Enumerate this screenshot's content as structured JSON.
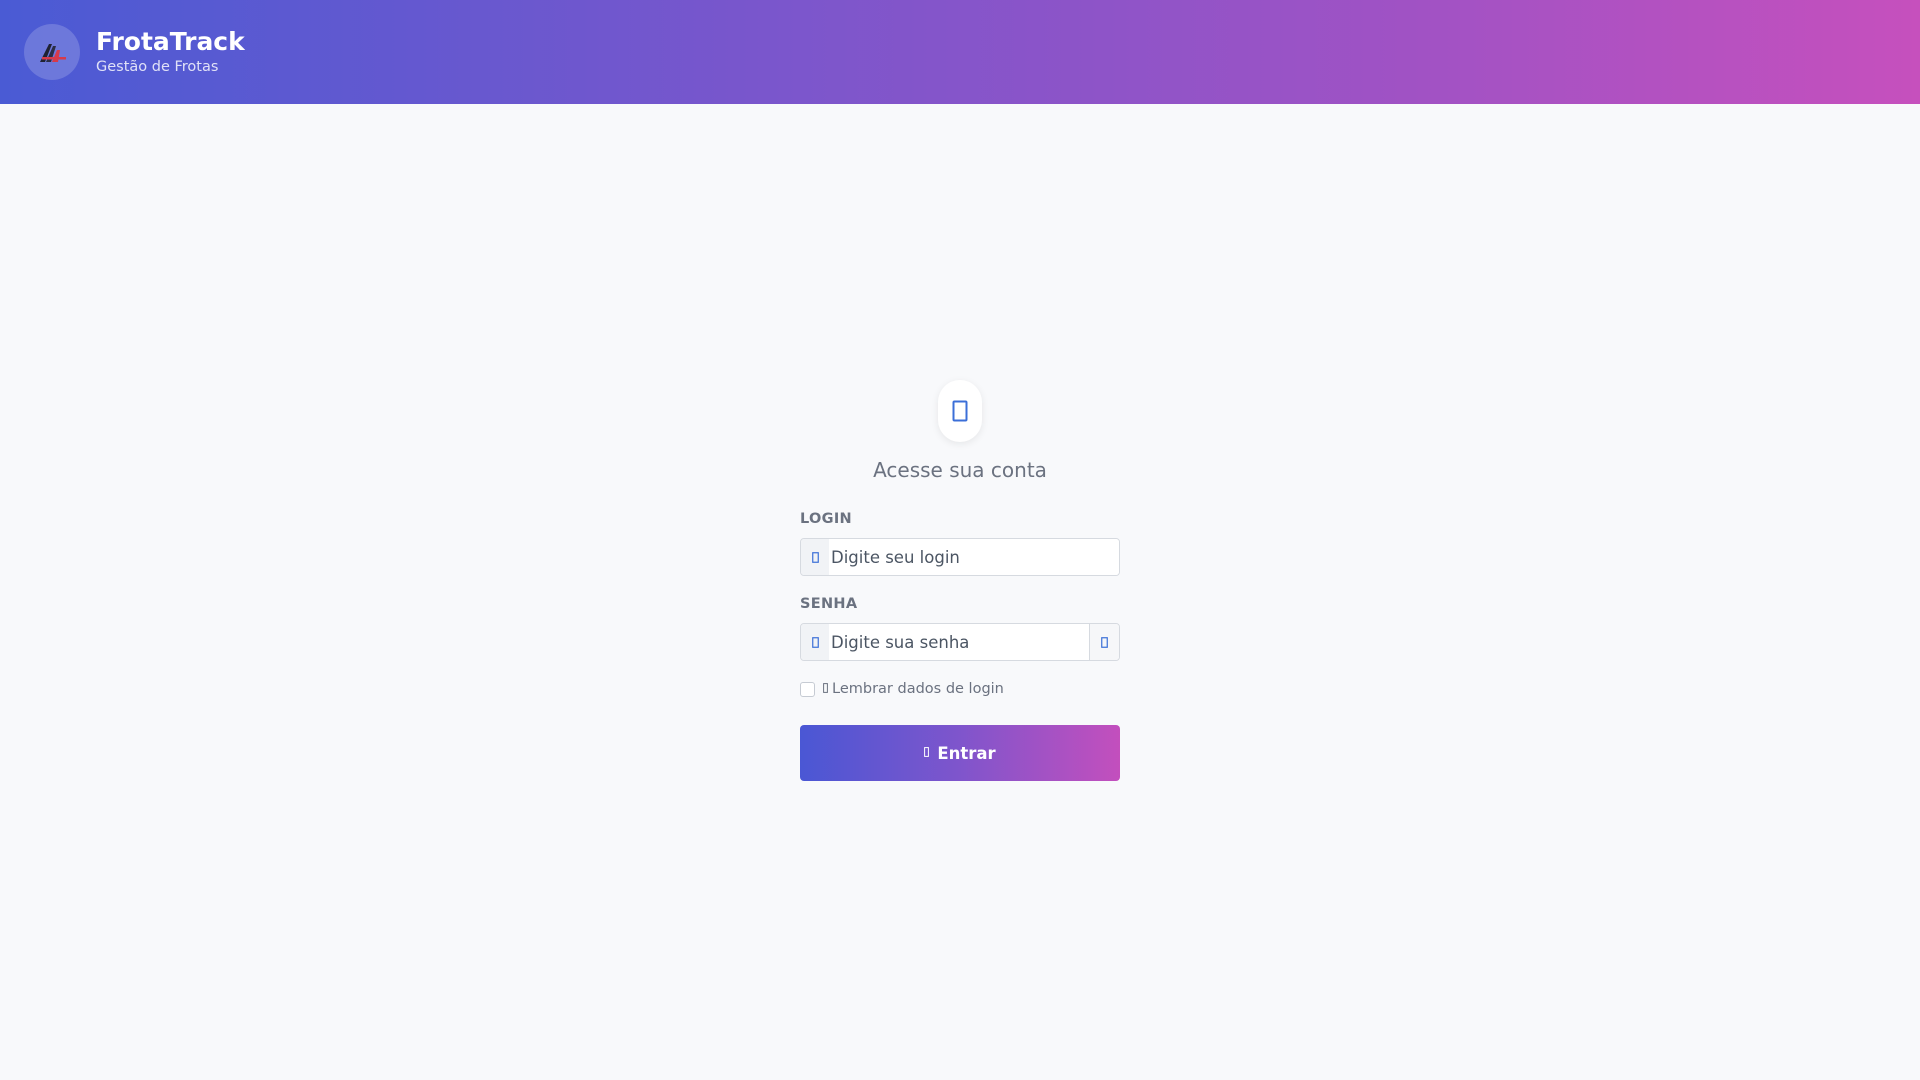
{
  "header": {
    "brand_name": "FrotaTrack",
    "brand_subtitle": "Gestão de Frotas",
    "logo_icon": "road-logo-icon",
    "gradient_start": "#4a5bd4",
    "gradient_end": "#c650bd"
  },
  "login": {
    "avatar_icon": "user-icon",
    "title": "Acesse sua conta",
    "login_label": "LOGIN",
    "login_placeholder": "Digite seu login",
    "login_icon": "user-icon",
    "password_label": "SENHA",
    "password_placeholder": "Digite sua senha",
    "password_icon": "lock-icon",
    "toggle_icon": "eye-icon",
    "remember_label": "Lembrar dados de login",
    "remember_checked": false,
    "submit_label": "Entrar",
    "submit_icon": "sign-in-icon",
    "accent_color": "#3b6fd8"
  }
}
